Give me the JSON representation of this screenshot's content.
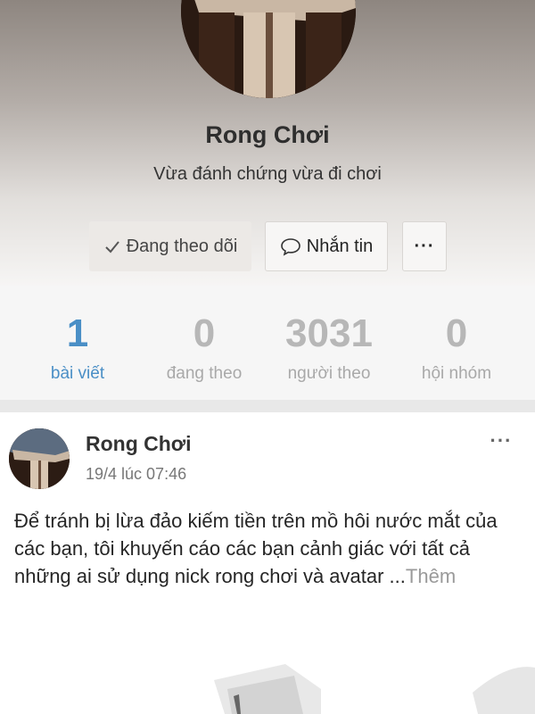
{
  "profile": {
    "name": "Rong Chơi",
    "bio": "Vừa đánh chứng vừa đi chơi",
    "following_button": "Đang theo dõi",
    "message_button": "Nhắn tin",
    "more_button": "···"
  },
  "stats": [
    {
      "value": "1",
      "label": "bài viết"
    },
    {
      "value": "0",
      "label": "đang theo"
    },
    {
      "value": "3031",
      "label": "người theo"
    },
    {
      "value": "0",
      "label": "hội nhóm"
    }
  ],
  "post": {
    "author": "Rong Chơi",
    "time": "19/4 lúc 07:46",
    "more": "···",
    "text": "Để tránh bị lừa đảo kiếm tiền trên mồ hôi nước mắt của các bạn, tôi khuyến cáo các bạn cảnh giác với tất cả những ai sử dụng nick rong chơi và avatar ...",
    "see_more": "Thêm"
  },
  "colors": {
    "accent": "#4a8fc6",
    "muted": "#b7b7b7"
  },
  "icons": {
    "check": "check-icon",
    "message": "chat-bubble-icon"
  }
}
